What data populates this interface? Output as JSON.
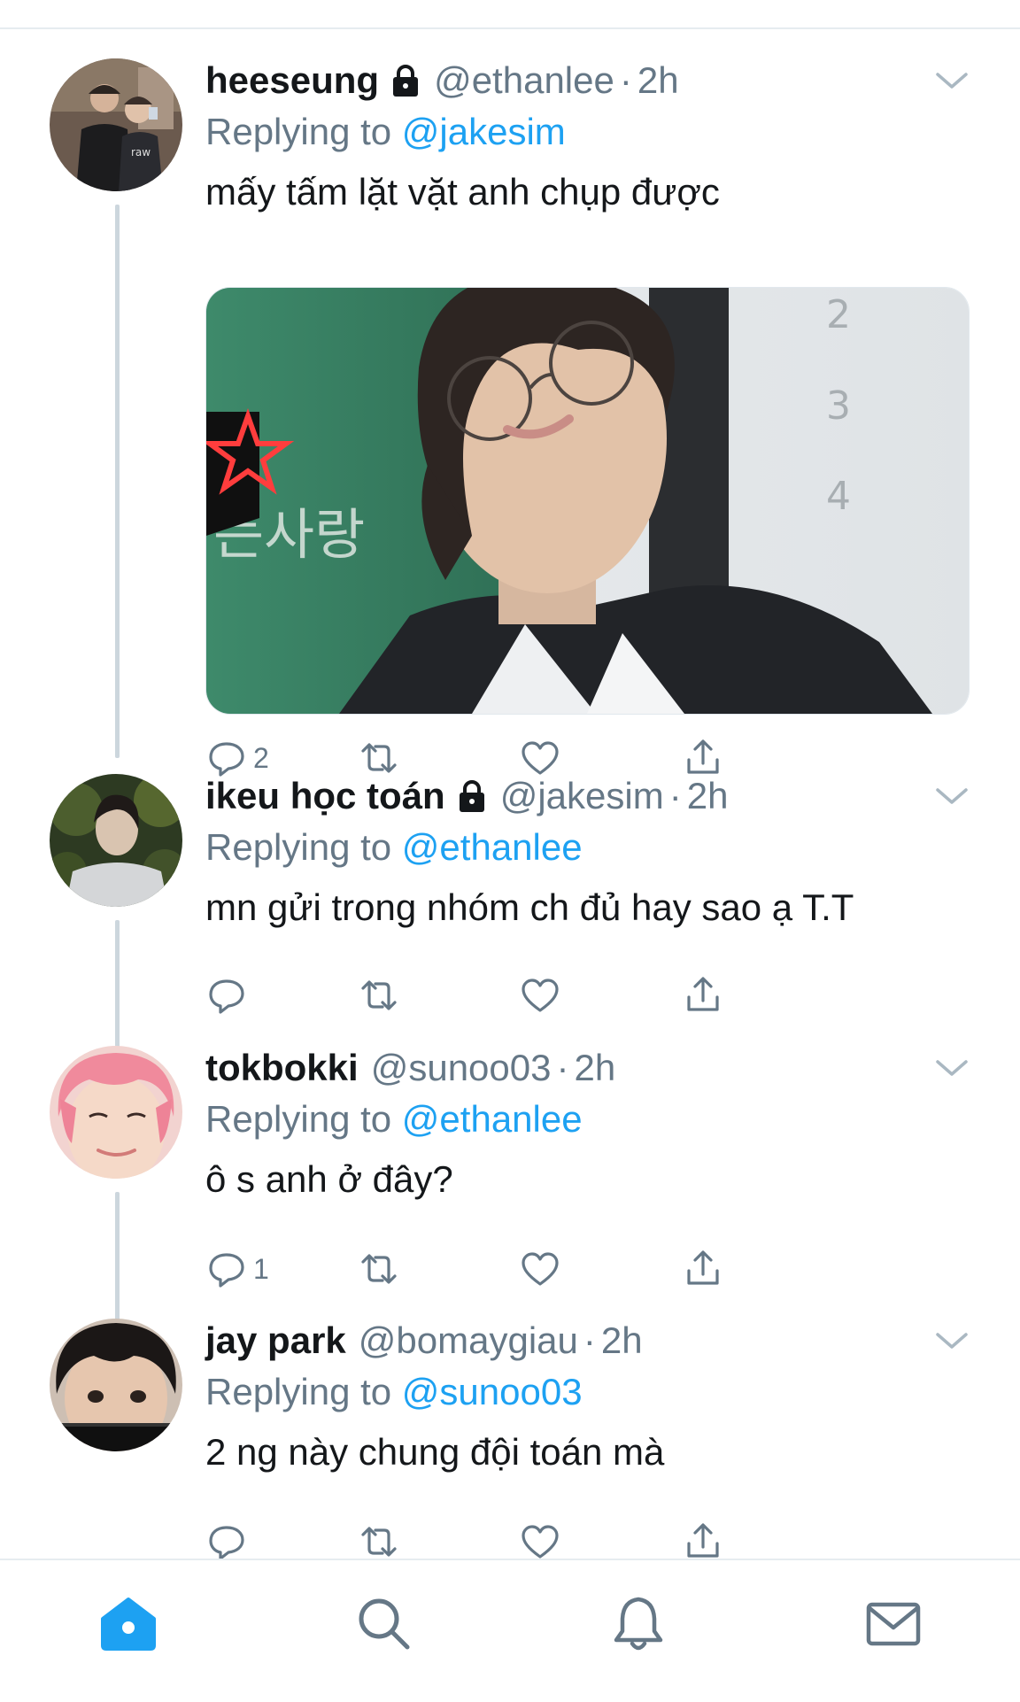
{
  "tweets": [
    {
      "name": "heeseung",
      "locked": true,
      "handle": "@ethanlee",
      "dot": "·",
      "time": "2h",
      "replying_prefix": "Replying to",
      "replying_to": "@jakesim",
      "text": "mấy tấm lặt vặt anh chụp được",
      "has_media": true,
      "reply_count": "2"
    },
    {
      "name": "ikeu học toán",
      "locked": true,
      "handle": "@jakesim",
      "dot": "·",
      "time": "2h",
      "replying_prefix": "Replying to",
      "replying_to": "@ethanlee",
      "text": "mn gửi trong nhóm ch đủ hay sao ạ T.T",
      "has_media": false,
      "reply_count": ""
    },
    {
      "name": "tokbokki",
      "locked": false,
      "handle": "@sunoo03",
      "dot": "·",
      "time": "2h",
      "replying_prefix": "Replying to",
      "replying_to": "@ethanlee",
      "text": "ô s anh ở đây?",
      "has_media": false,
      "reply_count": "1"
    },
    {
      "name": "jay park",
      "locked": false,
      "handle": "@bomaygiau",
      "dot": "·",
      "time": "2h",
      "replying_prefix": "Replying to",
      "replying_to": "@sunoo03",
      "text": "2 ng này chung đội toán mà",
      "has_media": false,
      "reply_count": ""
    }
  ],
  "media_image": {
    "overlay_text": "는사랑",
    "board_numbers": [
      "2",
      "3",
      "4"
    ]
  },
  "nav": {
    "items": [
      "home-icon",
      "search-icon",
      "bell-icon",
      "mail-icon"
    ],
    "active": "home-icon"
  },
  "colors": {
    "accent": "#1da1f2",
    "secondary_text": "#657786",
    "primary_text": "#14171a",
    "thread_line": "#ccd6dd"
  }
}
